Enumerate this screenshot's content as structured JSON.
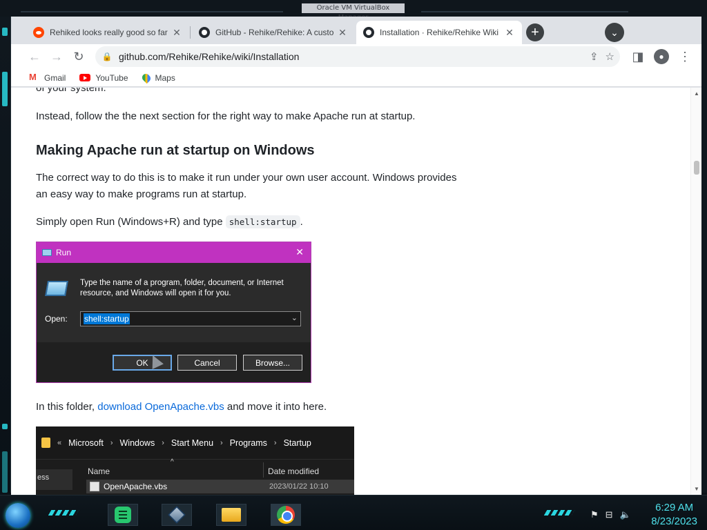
{
  "window_title": "Oracle VM VirtualBox Manager",
  "tabs": [
    {
      "title": "Rehiked looks really good so far",
      "favicon": "reddit-icon",
      "active": false
    },
    {
      "title": "GitHub - Rehike/Rehike: A custo",
      "favicon": "github-icon",
      "active": false
    },
    {
      "title": "Installation · Rehike/Rehike Wiki",
      "favicon": "github-icon",
      "active": true
    }
  ],
  "address_bar": {
    "url": "github.com/Rehike/Rehike/wiki/Installation"
  },
  "bookmarks": [
    "Gmail",
    "YouTube",
    "Maps"
  ],
  "article": {
    "cutoff_text": "of your system.",
    "p1": "Instead, follow the the next section for the right way to make Apache run at startup.",
    "heading": "Making Apache run at startup on Windows",
    "p2_line1": "The correct way to do this is to make it run under your own user account. Windows provides",
    "p2_line2": "an easy way to make programs run at startup.",
    "p3_text": "Simply open Run (Windows+R) and type",
    "p3_code": "shell:startup",
    "p3_end": ".",
    "p4_before": "In this folder,",
    "p4_link": "download OpenApache.vbs",
    "p4_after": "and move it into here."
  },
  "run_dialog": {
    "title": "Run",
    "description": "Type the name of a program, folder, document, or Internet resource, and Windows will open it for you.",
    "open_label": "Open:",
    "input_value": "shell:startup",
    "buttons": {
      "ok": "OK",
      "cancel": "Cancel",
      "browse": "Browse..."
    }
  },
  "explorer": {
    "breadcrumb": [
      "Microsoft",
      "Windows",
      "Start Menu",
      "Programs",
      "Startup"
    ],
    "col_name": "Name",
    "col_date": "Date modified",
    "nav_item": "ess",
    "file": {
      "name": "OpenApache.vbs",
      "date": "2023/01/22 10:10"
    }
  },
  "taskbar": {
    "time": "6:29 AM",
    "date": "8/23/2023"
  },
  "colors": {
    "run_title": "#c032c0",
    "link": "#0969da",
    "clock": "#4fe0ea"
  }
}
